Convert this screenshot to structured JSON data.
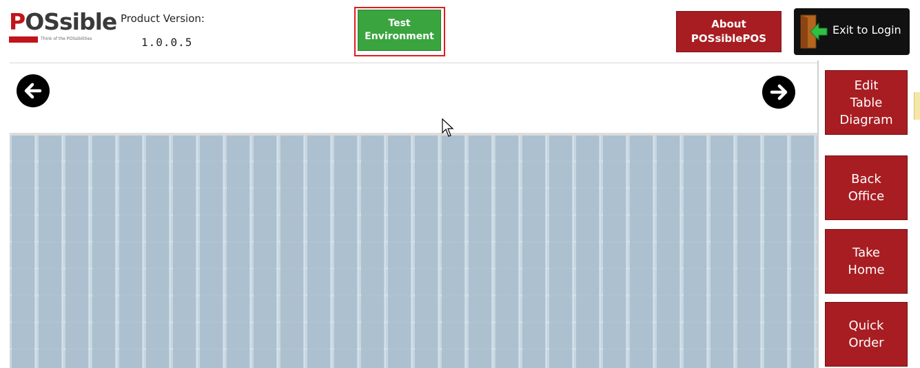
{
  "header": {
    "logo": {
      "text_red": "P",
      "text_rest": "OSsible",
      "tagline": "Think of the POSsibilities"
    },
    "product_version_label": "Product Version:",
    "product_version_value": "1.0.0.5",
    "test_environment_label": "Test\nEnvironment",
    "about_label": "About\nPOSsiblePOS",
    "exit_label": "Exit to Login"
  },
  "nav": {
    "left_arrow_icon": "arrow-left-circle-icon",
    "right_arrow_icon": "arrow-right-circle-icon"
  },
  "sidebar": {
    "items": [
      {
        "label": "Edit\nTable\nDiagram"
      },
      {
        "label": "Back\nOffice"
      },
      {
        "label": "Take\nHome"
      },
      {
        "label": "Quick\nOrder"
      }
    ]
  },
  "colors": {
    "green_button": "#3aa43f",
    "red_button": "#a81d22",
    "grid_tile": "#a4b9ca",
    "frame_red": "#e11a1a"
  }
}
